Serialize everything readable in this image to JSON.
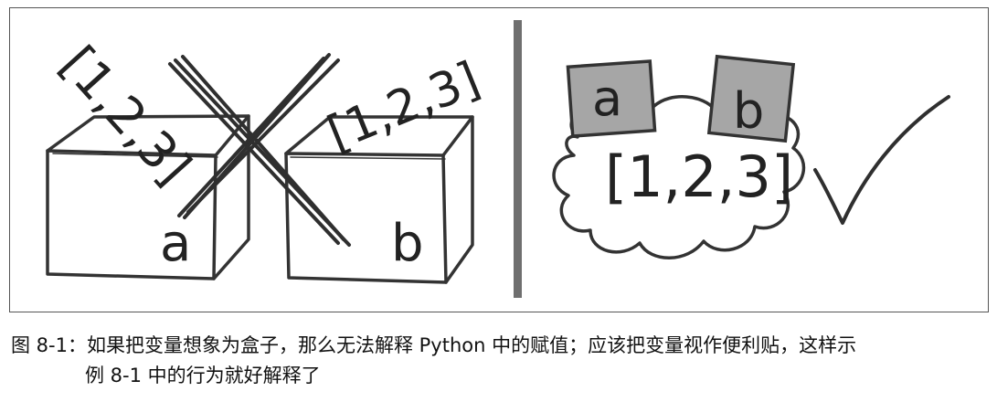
{
  "figure": {
    "left_panel": {
      "box_a_label": "a",
      "box_b_label": "b",
      "list_spilled_text": "[1,2,3]",
      "list_on_box_b_text": "[1,2,3]"
    },
    "right_panel": {
      "note_a_label": "a",
      "note_b_label": "b",
      "cloud_list_text": "[1,2,3]"
    },
    "colors": {
      "ink": "#2a2a2a",
      "divider": "#6f6f6f",
      "sticky_note": "#a6a6a6"
    }
  },
  "caption": {
    "line1": "图 8-1：如果把变量想象为盒子，那么无法解释 Python 中的赋值；应该把变量视作便利贴，这样示",
    "line2": "例 8-1 中的行为就好解释了"
  }
}
